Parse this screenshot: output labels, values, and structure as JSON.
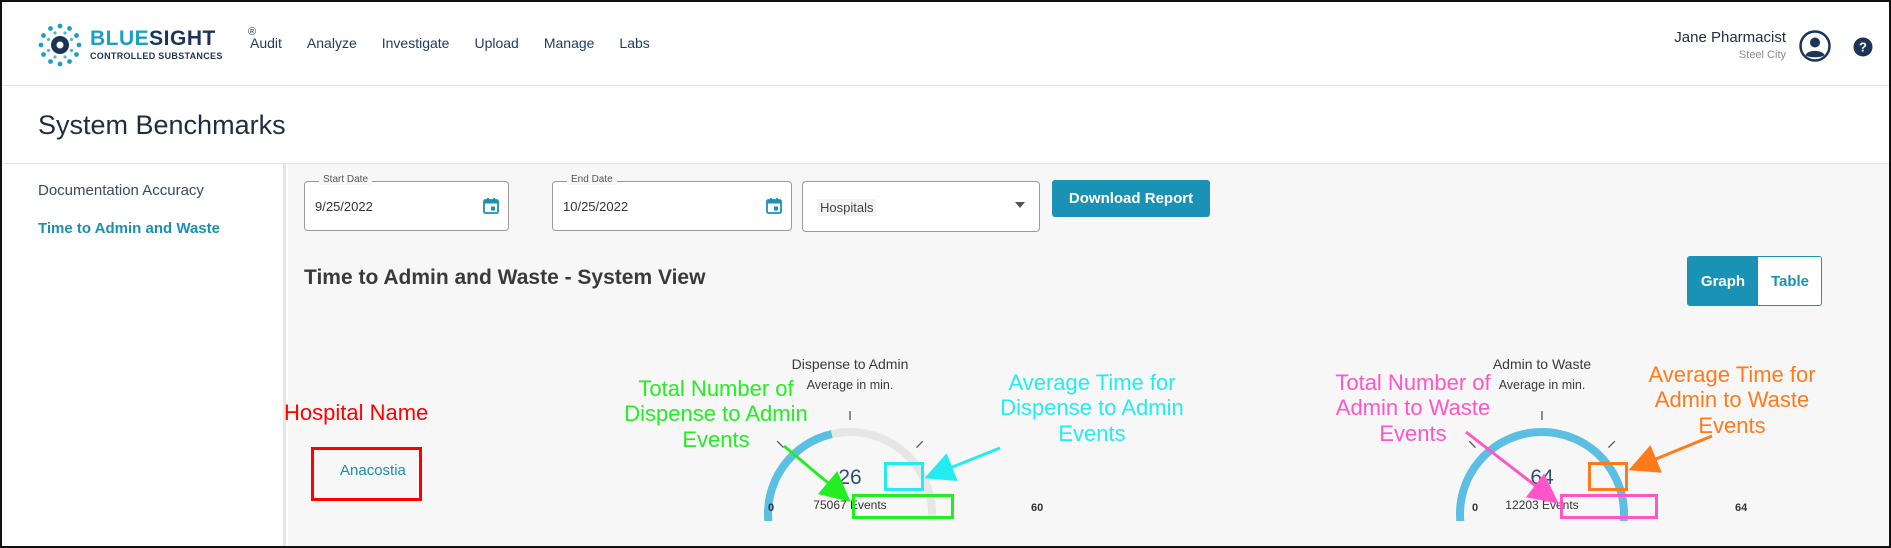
{
  "brand": {
    "name_part1": "BLUE",
    "name_part2": "SIGHT",
    "registered": "®",
    "subtitle": "CONTROLLED SUBSTANCES"
  },
  "nav": {
    "items": [
      {
        "label": "Audit"
      },
      {
        "label": "Analyze"
      },
      {
        "label": "Investigate"
      },
      {
        "label": "Upload"
      },
      {
        "label": "Manage"
      },
      {
        "label": "Labs"
      }
    ]
  },
  "user": {
    "name": "Jane Pharmacist",
    "location": "Steel City",
    "avatar_icon": "user-circle-icon",
    "help_icon": "help-circle-icon"
  },
  "page": {
    "title": "System Benchmarks"
  },
  "sidebar": {
    "items": [
      {
        "label": "Documentation Accuracy",
        "active": false
      },
      {
        "label": "Time to Admin and Waste",
        "active": true
      }
    ]
  },
  "filters": {
    "start_date_label": "Start Date",
    "start_date_value": "9/25/2022",
    "end_date_label": "End Date",
    "end_date_value": "10/25/2022",
    "hospitals_value": "Hospitals",
    "calendar_icon": "calendar-icon",
    "download_label": "Download Report"
  },
  "section": {
    "title": "Time to Admin and Waste - System View",
    "view_toggle": {
      "graph": "Graph",
      "table": "Table",
      "selected": "Graph"
    }
  },
  "rows": [
    {
      "hospital": "Anacostia",
      "gauges": [
        {
          "title": "Dispense to Admin",
          "subtitle": "Average in min.",
          "value": 26,
          "min": 0,
          "max": 60,
          "events": "75067 Events"
        },
        {
          "title": "Admin to Waste",
          "subtitle": "Average in min.",
          "value": 64,
          "min": 0,
          "max": 64,
          "events": "12203 Events"
        }
      ]
    }
  ],
  "annotations": {
    "hospital_name": "Hospital Name",
    "total_dispense": [
      "Total Number of",
      "Dispense to Admin",
      "Events"
    ],
    "avg_dispense": [
      "Average Time for",
      "Dispense to Admin",
      "Events"
    ],
    "total_waste": [
      "Total Number of",
      "Admin to Waste",
      "Events"
    ],
    "avg_waste": [
      "Average Time for",
      "Admin to Waste",
      "Events"
    ]
  },
  "colors": {
    "accent": "#1a92b5",
    "gauge_fill": "#5bbfe3",
    "gauge_track": "#e6e6e6",
    "annot_red": "#ff0000",
    "annot_green": "#22ee22",
    "annot_cyan": "#22ecf0",
    "annot_pink": "#ff55c8",
    "annot_orange": "#ff7a1a"
  }
}
